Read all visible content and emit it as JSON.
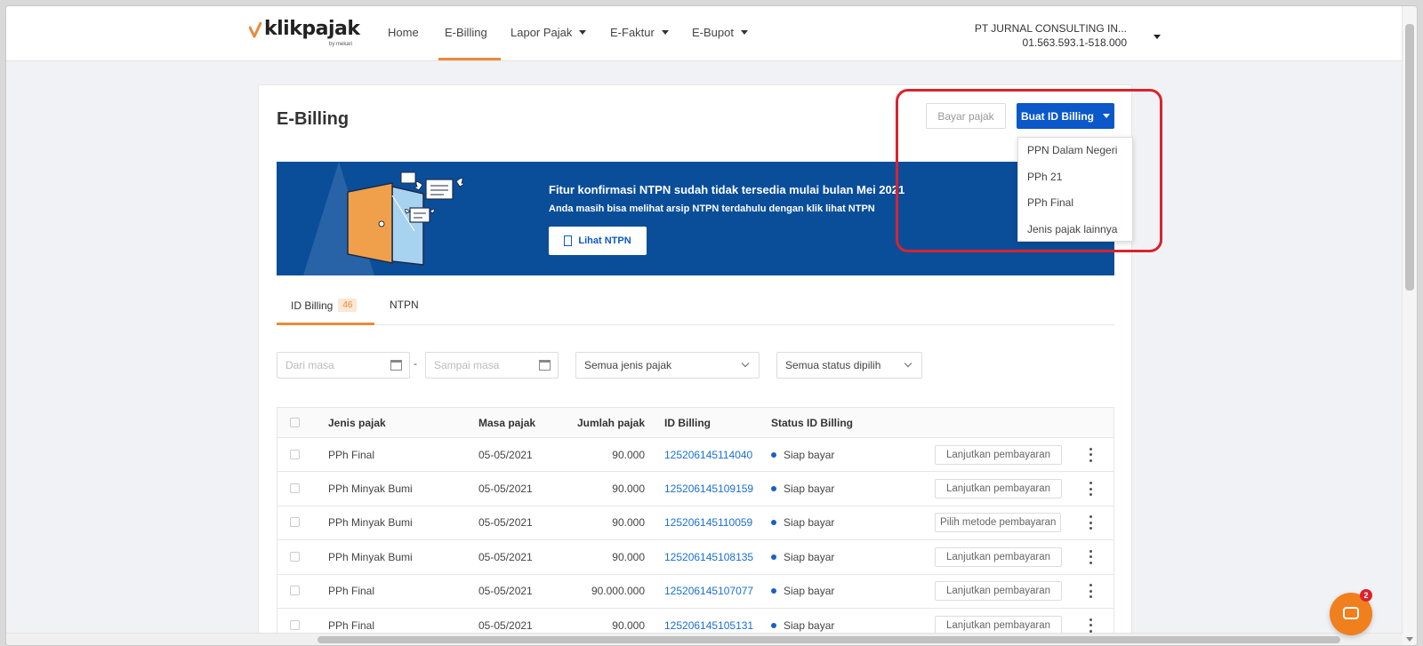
{
  "colors": {
    "brand_orange": "#e98a3a",
    "primary_blue": "#0a58ca",
    "banner_blue": "#0a4e9a",
    "highlight_red": "#d9232d",
    "link_blue": "#1a6fd1"
  },
  "logo": {
    "text": "klikpajak",
    "sub": "by mekari"
  },
  "nav": {
    "items": [
      {
        "label": "Home",
        "has_caret": false
      },
      {
        "label": "E-Billing",
        "has_caret": false,
        "active": true
      },
      {
        "label": "Lapor Pajak",
        "has_caret": true
      },
      {
        "label": "E-Faktur",
        "has_caret": true
      },
      {
        "label": "E-Bupot",
        "has_caret": true
      }
    ]
  },
  "company": {
    "name": "PT JURNAL CONSULTING IN...",
    "npwp": "01.563.593.1-518.000"
  },
  "page": {
    "title": "E-Billing"
  },
  "actions": {
    "bayar_label": "Bayar pajak",
    "buat_label": "Buat ID Billing",
    "dropdown": [
      "PPN Dalam Negeri",
      "PPh 21",
      "PPh Final",
      "Jenis pajak lainnya"
    ]
  },
  "banner": {
    "title": "Fitur konfirmasi NTPN sudah tidak tersedia mulai bulan Mei 2021",
    "subtitle": "Anda masih bisa melihat arsip NTPN terdahulu dengan klik lihat NTPN",
    "button_label": "Lihat NTPN"
  },
  "tabs": [
    {
      "label": "ID Billing",
      "badge": "46",
      "active": true
    },
    {
      "label": "NTPN"
    }
  ],
  "filters": {
    "dari_placeholder": "Dari masa",
    "sampai_placeholder": "Sampai masa",
    "separator": "-",
    "jenis_value": "Semua jenis pajak",
    "status_value": "Semua status dipilih"
  },
  "table": {
    "columns": [
      "Jenis pajak",
      "Masa pajak",
      "Jumlah pajak",
      "ID Billing",
      "Status ID Billing"
    ],
    "rows": [
      {
        "jenis": "PPh Final",
        "masa": "05-05/2021",
        "jumlah": "90.000",
        "id": "125206145114040",
        "status": "Siap bayar",
        "action": "Lanjutkan pembayaran"
      },
      {
        "jenis": "PPh Minyak Bumi",
        "masa": "05-05/2021",
        "jumlah": "90.000",
        "id": "125206145109159",
        "status": "Siap bayar",
        "action": "Lanjutkan pembayaran"
      },
      {
        "jenis": "PPh Minyak Bumi",
        "masa": "05-05/2021",
        "jumlah": "90.000",
        "id": "125206145110059",
        "status": "Siap bayar",
        "action": "Pilih metode pembayaran"
      },
      {
        "jenis": "PPh Minyak Bumi",
        "masa": "05-05/2021",
        "jumlah": "90.000",
        "id": "125206145108135",
        "status": "Siap bayar",
        "action": "Lanjutkan pembayaran"
      },
      {
        "jenis": "PPh Final",
        "masa": "05-05/2021",
        "jumlah": "90.000.000",
        "id": "125206145107077",
        "status": "Siap bayar",
        "action": "Lanjutkan pembayaran"
      },
      {
        "jenis": "PPh Final",
        "masa": "05-05/2021",
        "jumlah": "90.000",
        "id": "125206145105131",
        "status": "Siap bayar",
        "action": "Lanjutkan pembayaran"
      }
    ]
  },
  "chat": {
    "badge": "2"
  }
}
